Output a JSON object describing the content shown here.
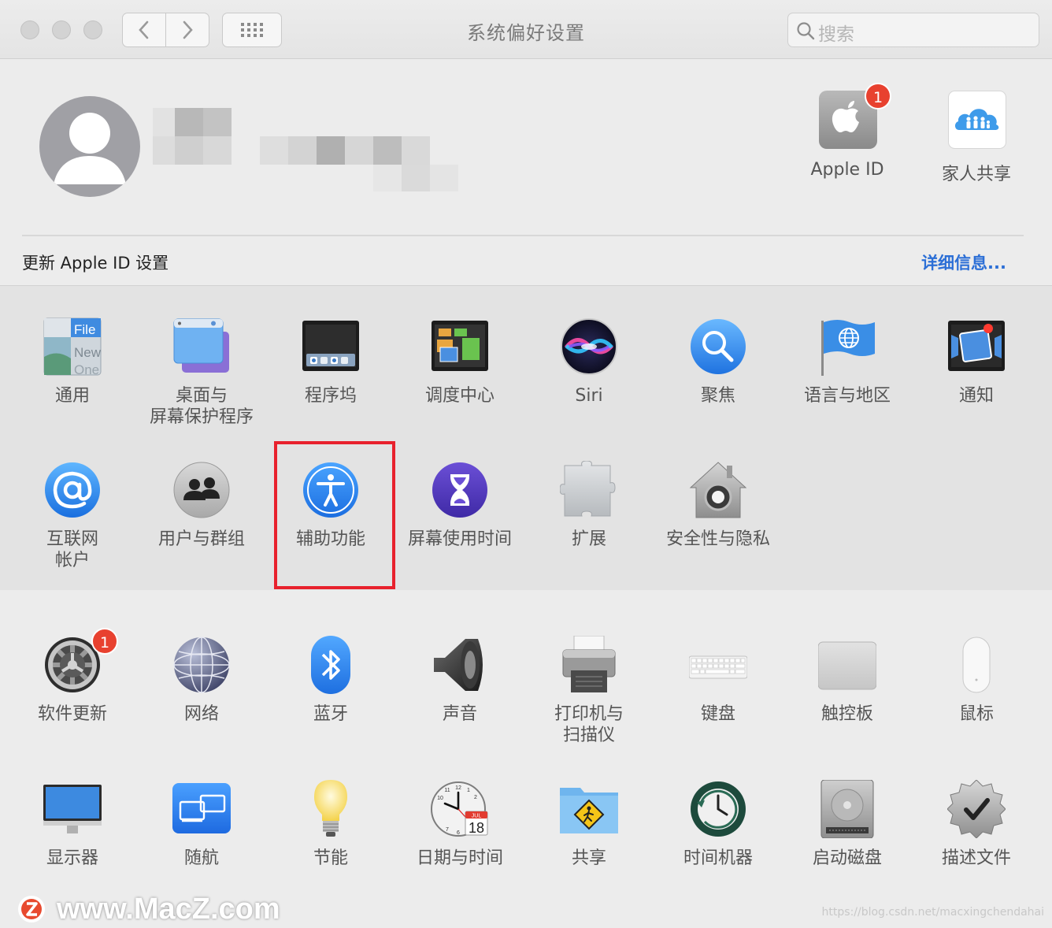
{
  "window": {
    "title": "系统偏好设置"
  },
  "search": {
    "placeholder": "搜索"
  },
  "account": {
    "update_text": "更新 Apple ID 设置",
    "details_link": "详细信息...",
    "apple_id": {
      "label": "Apple ID",
      "badge": "1"
    },
    "family": {
      "label": "家人共享"
    }
  },
  "prefs": {
    "general": "通用",
    "desktop": "桌面与\n屏幕保护程序",
    "dock": "程序坞",
    "mission": "调度中心",
    "siri": "Siri",
    "spotlight": "聚焦",
    "language": "语言与地区",
    "notifications": "通知",
    "internet": "互联网\n帐户",
    "users": "用户与群组",
    "accessibility": "辅助功能",
    "screentime": "屏幕使用时间",
    "extensions": "扩展",
    "security": "安全性与隐私",
    "software_update": "软件更新",
    "software_update_badge": "1",
    "network": "网络",
    "bluetooth": "蓝牙",
    "sound": "声音",
    "printers": "打印机与\n扫描仪",
    "keyboard": "键盘",
    "trackpad": "触控板",
    "mouse": "鼠标",
    "displays": "显示器",
    "sidecar": "随航",
    "energy": "节能",
    "datetime": "日期与时间",
    "sharing": "共享",
    "timemachine": "时间机器",
    "startup": "启动磁盘",
    "profiles": "描述文件"
  },
  "icon_text": {
    "general_file": "File",
    "general_new": "New",
    "general_one": "One",
    "calendar_month": "JUL",
    "calendar_day": "18",
    "clock_12": "12",
    "clock_1": "1",
    "clock_2": "2",
    "clock_10": "10",
    "clock_11": "11",
    "clock_7": "7",
    "clock_6": "6"
  },
  "watermark": {
    "text": "www.MacZ.com",
    "url": "https://blog.csdn.net/macxingchendahai"
  },
  "colors": {
    "highlight": "#e8212d",
    "link": "#2c6fd6",
    "badge": "#e8412f"
  }
}
